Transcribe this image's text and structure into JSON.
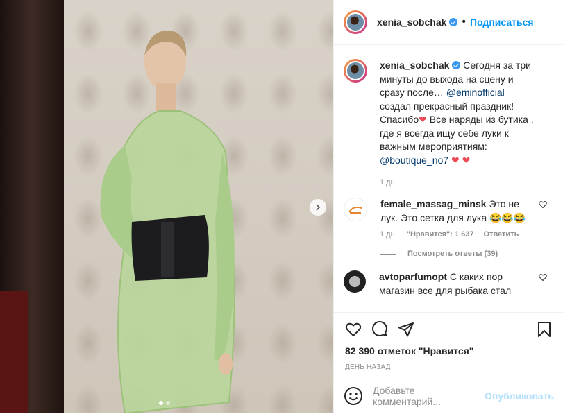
{
  "post": {
    "username": "xenia_sobchak",
    "follow_label": "Подписаться",
    "separator": "•"
  },
  "caption": {
    "username": "xenia_sobchak",
    "text_1": "Сегодня за три минуты до выхода на сцену и сразу после… ",
    "mention_1": "@eminofficial",
    "text_2": " создал прекрасный праздник! Спасибо",
    "text_3": " Все наряды из бутика , где я всегда ищу себе луки к важным мероприятиям: ",
    "mention_2": "@boutique_no7",
    "heart": "❤",
    "time": "1 дн."
  },
  "comments": [
    {
      "username": "female_massag_minsk",
      "text": "Это не лук. Это сетка для лука 😂😂😂",
      "time": "1 дн.",
      "likes": "\"Нравится\": 1 637",
      "reply": "Ответить",
      "view_replies": "Посмотреть ответы (39)"
    },
    {
      "username": "avtoparfumopt",
      "text": "С каких пор магазин все для рыбака стал"
    }
  ],
  "likes_count": "82 390 отметок \"Нравится\"",
  "date": "ДЕНЬ НАЗАД",
  "add_comment": {
    "placeholder": "Добавьте комментарий...",
    "publish": "Опубликовать"
  },
  "colors": {
    "accent": "#0095f6",
    "heart": "#ed4956",
    "muted": "#8e8e8e"
  }
}
